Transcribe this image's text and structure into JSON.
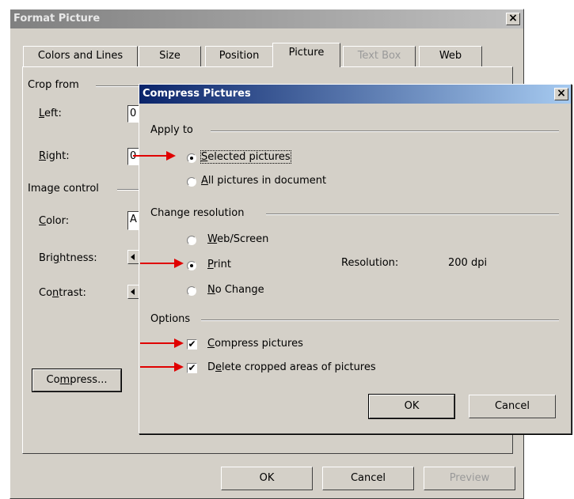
{
  "outer": {
    "title": "Format Picture",
    "close": "×",
    "tabs": [
      "Colors and Lines",
      "Size",
      "Position",
      "Picture",
      "Text Box",
      "Web"
    ],
    "crop": {
      "group": "Crop from",
      "left": {
        "pre": "",
        "u": "L",
        "post": "eft:"
      },
      "left_value": "0",
      "right": {
        "pre": "",
        "u": "R",
        "post": "ight:"
      },
      "right_value": "0"
    },
    "image_control": {
      "group": "Image control",
      "color": {
        "pre": "",
        "u": "C",
        "post": "olor:"
      },
      "color_value": "A",
      "brightness": {
        "pre": "Bri",
        "u": "g",
        "post": "htness:"
      },
      "contrast": {
        "pre": "Co",
        "u": "n",
        "post": "trast:"
      }
    },
    "compress_button": {
      "pre": "Co",
      "u": "m",
      "post": "press..."
    },
    "buttons": {
      "ok": "OK",
      "cancel": "Cancel",
      "preview": "Preview"
    }
  },
  "inner": {
    "title": "Compress Pictures",
    "close": "×",
    "apply_to": {
      "group": "Apply to",
      "selected": {
        "pre": "",
        "u": "S",
        "post": "elected pictures",
        "checked": true
      },
      "all": {
        "pre": "",
        "u": "A",
        "post": "ll pictures in document",
        "checked": false
      }
    },
    "resolution": {
      "group": "Change resolution",
      "web": {
        "pre": "",
        "u": "W",
        "post": "eb/Screen",
        "checked": false
      },
      "print": {
        "pre": "",
        "u": "P",
        "post": "rint",
        "checked": true
      },
      "nochange": {
        "pre": "",
        "u": "N",
        "post": "o Change",
        "checked": false
      },
      "label": "Resolution:",
      "value": "200 dpi"
    },
    "options": {
      "group": "Options",
      "compress": {
        "pre": "",
        "u": "C",
        "post": "ompress pictures",
        "checked": true
      },
      "delete": {
        "pre": "D",
        "u": "e",
        "post": "lete cropped areas of pictures",
        "checked": true
      }
    },
    "buttons": {
      "ok": "OK",
      "cancel": "Cancel"
    },
    "check_glyph": "✔"
  },
  "colors": {
    "arrow": "#e00000",
    "active_title": "#0a246a",
    "inactive_title": "#808080",
    "dialog_bg": "#d4d0c8"
  }
}
